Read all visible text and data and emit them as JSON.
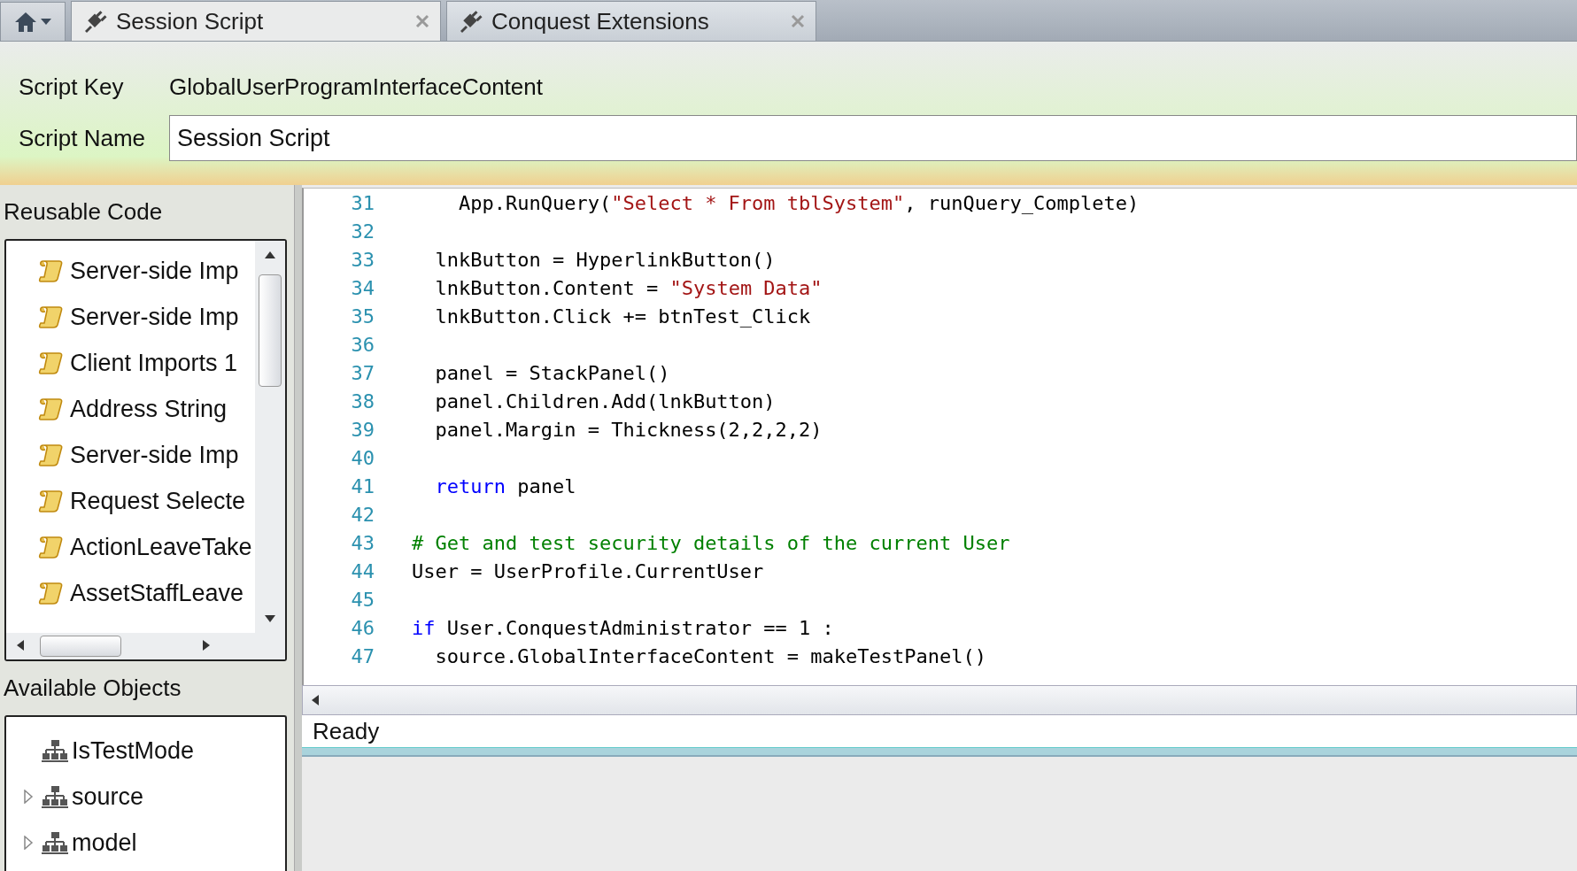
{
  "tabs": [
    {
      "label": "Session Script",
      "selected": true
    },
    {
      "label": "Conquest Extensions",
      "selected": false
    }
  ],
  "form": {
    "script_key_label": "Script Key",
    "script_key": "GlobalUserProgramInterfaceContent",
    "script_name_label": "Script Name",
    "script_name": "Session Script"
  },
  "reusable_code": {
    "title": "Reusable Code",
    "items": [
      "Server-side Imp",
      "Server-side Imp",
      "Client Imports 1",
      "Address String",
      "Server-side Imp",
      "Request Selecte",
      "ActionLeaveTake",
      "AssetStaffLeave"
    ]
  },
  "available_objects": {
    "title": "Available Objects",
    "items": [
      {
        "label": "IsTestMode",
        "kind": "leaf"
      },
      {
        "label": "source",
        "kind": "node",
        "expanded": false
      },
      {
        "label": "model",
        "kind": "node",
        "expanded": false
      }
    ]
  },
  "editor": {
    "lines": [
      {
        "number": "31",
        "segments": [
          {
            "kind": "plain",
            "text": "    App.RunQuery("
          },
          {
            "kind": "string",
            "text": "\"Select * From tblSystem\""
          },
          {
            "kind": "plain",
            "text": ", runQuery_Complete)"
          }
        ]
      },
      {
        "number": "32"
      },
      {
        "number": "33",
        "segments": [
          {
            "kind": "plain",
            "text": "  lnkButton = HyperlinkButton()"
          }
        ]
      },
      {
        "number": "34",
        "segments": [
          {
            "kind": "plain",
            "text": "  lnkButton.Content = "
          },
          {
            "kind": "string",
            "text": "\"System Data\""
          }
        ]
      },
      {
        "number": "35",
        "segments": [
          {
            "kind": "plain",
            "text": "  lnkButton.Click += btnTest_Click"
          }
        ]
      },
      {
        "number": "36"
      },
      {
        "number": "37",
        "segments": [
          {
            "kind": "plain",
            "text": "  panel = StackPanel()"
          }
        ]
      },
      {
        "number": "38",
        "segments": [
          {
            "kind": "plain",
            "text": "  panel.Children.Add(lnkButton)"
          }
        ]
      },
      {
        "number": "39",
        "segments": [
          {
            "kind": "plain",
            "text": "  panel.Margin = Thickness(2,2,2,2)"
          }
        ]
      },
      {
        "number": "40"
      },
      {
        "number": "41",
        "segments": [
          {
            "kind": "keyword",
            "text": "  return"
          },
          {
            "kind": "plain",
            "text": " panel"
          }
        ]
      },
      {
        "number": "42"
      },
      {
        "number": "43",
        "segments": [
          {
            "kind": "comment",
            "text": "# Get and test security details of the current User"
          }
        ]
      },
      {
        "number": "44",
        "segments": [
          {
            "kind": "plain",
            "text": "User = UserProfile.CurrentUser"
          }
        ]
      },
      {
        "number": "45"
      },
      {
        "number": "46",
        "segments": [
          {
            "kind": "keyword",
            "text": "if"
          },
          {
            "kind": "plain",
            "text": " User.ConquestAdministrator == 1 :"
          }
        ]
      },
      {
        "number": "47",
        "segments": [
          {
            "kind": "plain",
            "text": "  source.GlobalInterfaceContent = makeTestPanel()"
          }
        ]
      }
    ]
  },
  "status": "Ready"
}
